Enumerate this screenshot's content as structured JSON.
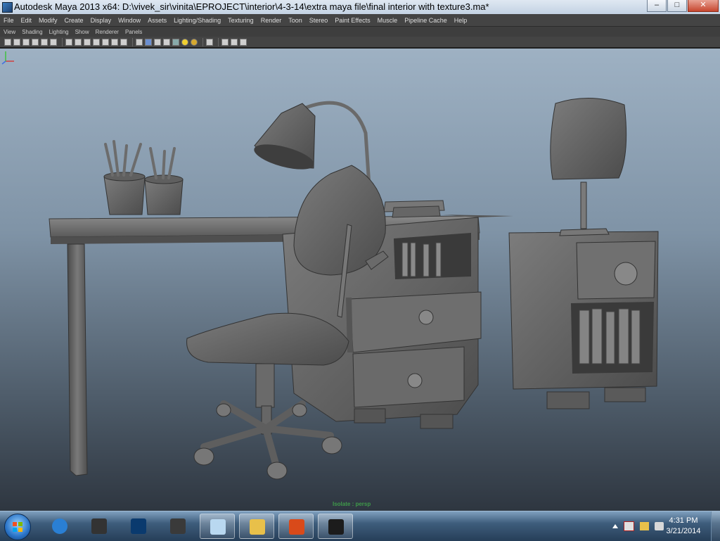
{
  "window": {
    "title": "Autodesk Maya 2013 x64: D:\\vivek_sir\\vinita\\EPROJECT\\interior\\4-3-14\\extra maya file\\final interior with texture3.ma*",
    "minimize": "–",
    "maximize": "□",
    "close": "✕"
  },
  "menubar": {
    "items": [
      "File",
      "Edit",
      "Modify",
      "Create",
      "Display",
      "Window",
      "Assets",
      "Lighting/Shading",
      "Texturing",
      "Render",
      "Toon",
      "Stereo",
      "Paint Effects",
      "Muscle",
      "Pipeline Cache",
      "Help"
    ]
  },
  "panel_menu": {
    "items": [
      "View",
      "Shading",
      "Lighting",
      "Show",
      "Renderer",
      "Panels"
    ]
  },
  "viewport": {
    "camera_label": "Isolate : persp"
  },
  "taskbar": {
    "apps": [
      {
        "icon": "internet-explorer-icon",
        "color": "#2a7fd4"
      },
      {
        "icon": "game-controller-icon",
        "color": "#333333"
      },
      {
        "icon": "photoshop-icon",
        "color": "#0a3a6e"
      },
      {
        "icon": "3ds-max-icon",
        "color": "#3a3a3a"
      },
      {
        "icon": "notes-icon",
        "color": "#b9d8f0"
      },
      {
        "icon": "folder-icon",
        "color": "#e8c04a"
      },
      {
        "icon": "office-icon",
        "color": "#d94a1a"
      },
      {
        "icon": "maya-icon",
        "color": "#1c1c1c"
      }
    ],
    "time": "4:31 PM",
    "date": "3/21/2014"
  }
}
